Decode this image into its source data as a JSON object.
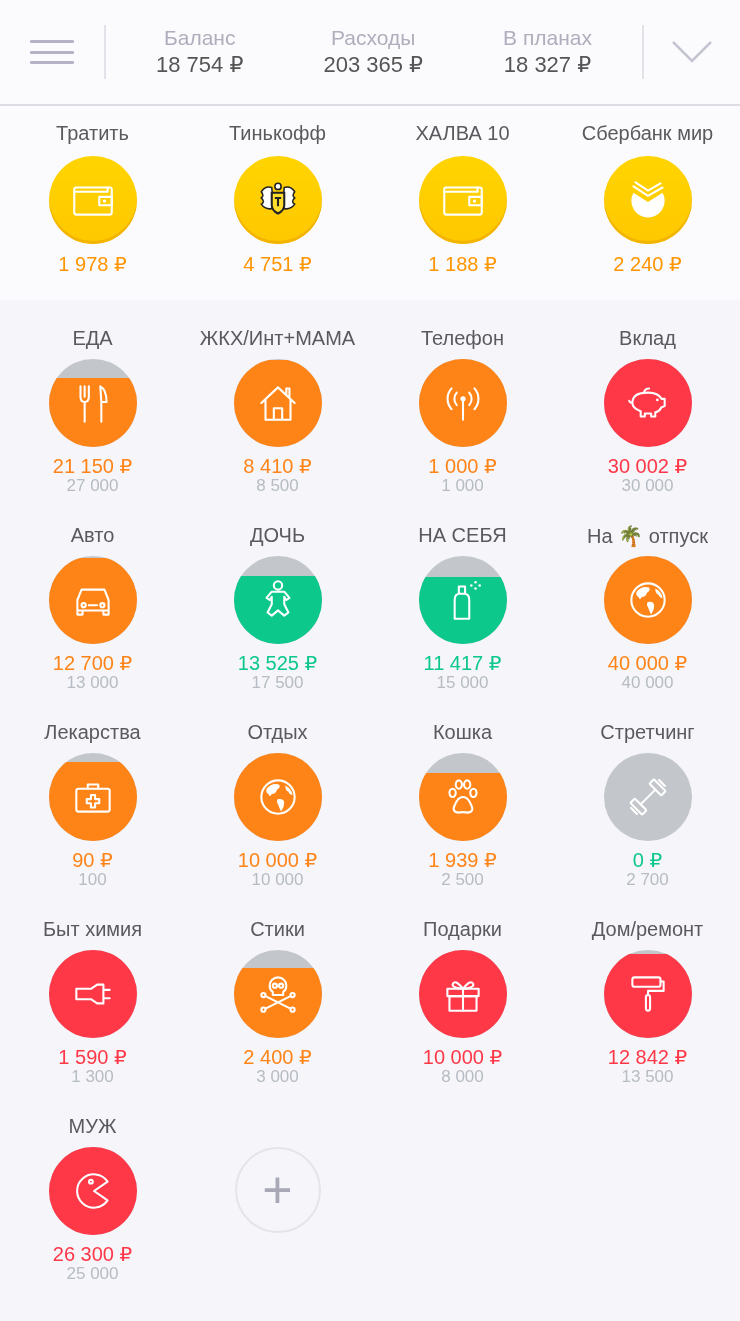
{
  "header": {
    "summary": [
      {
        "label": "Баланс",
        "value": "18 754 ₽"
      },
      {
        "label": "Расходы",
        "value": "203 365 ₽"
      },
      {
        "label": "В планах",
        "value": "18 327 ₽"
      }
    ]
  },
  "accounts": [
    {
      "name": "Тратить",
      "amount": "1 978 ₽"
    },
    {
      "name": "Тинькофф",
      "amount": "4 751 ₽"
    },
    {
      "name": "ХАЛВА 10",
      "amount": "1 188 ₽"
    },
    {
      "name": "Сбербанк мир",
      "amount": "2 240 ₽"
    }
  ],
  "categories": [
    {
      "name": "ЕДА",
      "amount": "21 150 ₽",
      "plan": "27 000",
      "color": "#ff8418"
    },
    {
      "name": "ЖКХ/Инт+МАМА",
      "amount": "8 410 ₽",
      "plan": "8 500",
      "color": "#ff8418"
    },
    {
      "name": "Телефон",
      "amount": "1 000 ₽",
      "plan": "1 000",
      "color": "#ff8418"
    },
    {
      "name": "Вклад",
      "amount": "30 002 ₽",
      "plan": "30 000",
      "color": "#ff3848"
    },
    {
      "name": "Авто",
      "amount": "12 700 ₽",
      "plan": "13 000",
      "color": "#ff8418"
    },
    {
      "name": "ДОЧЬ",
      "amount": "13 525 ₽",
      "plan": "17 500",
      "color": "#0cc88a"
    },
    {
      "name": "НА СЕБЯ",
      "amount": "11 417 ₽",
      "plan": "15 000",
      "color": "#0cc88a"
    },
    {
      "name": "На 🌴 отпуск",
      "amount": "40 000 ₽",
      "plan": "40 000",
      "color": "#ff8418"
    },
    {
      "name": "Лекарства",
      "amount": "90 ₽",
      "plan": "100",
      "color": "#ff8418"
    },
    {
      "name": "Отдых",
      "amount": "10 000 ₽",
      "plan": "10 000",
      "color": "#ff8418"
    },
    {
      "name": "Кошка",
      "amount": "1 939 ₽",
      "plan": "2 500",
      "color": "#ff8418"
    },
    {
      "name": "Стретчинг",
      "amount": "0 ₽",
      "plan": "2 700",
      "color": "#0cc88a"
    },
    {
      "name": "Быт химия",
      "amount": "1 590 ₽",
      "plan": "1 300",
      "color": "#ff3848"
    },
    {
      "name": "Стики",
      "amount": "2 400 ₽",
      "plan": "3 000",
      "color": "#ff8418"
    },
    {
      "name": "Подарки",
      "amount": "10 000 ₽",
      "plan": "8 000",
      "color": "#ff3848"
    },
    {
      "name": "Дом/ремонт",
      "amount": "12 842 ₽",
      "plan": "13 500",
      "color": "#ff3848"
    },
    {
      "name": "МУЖ",
      "amount": "26 300 ₽",
      "plan": "25 000",
      "color": "#ff3848"
    }
  ],
  "add_button": "+"
}
